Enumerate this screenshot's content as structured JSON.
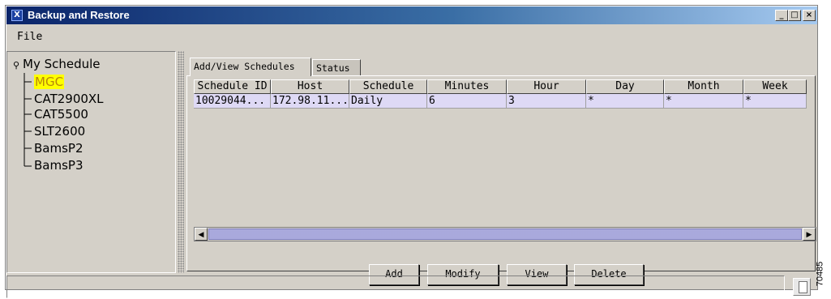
{
  "window": {
    "title": "Backup and Restore",
    "icon_glyph": "X",
    "buttons": {
      "minimize": "_",
      "maximize": "□",
      "close": "×"
    }
  },
  "menubar": {
    "items": [
      "File"
    ]
  },
  "tree": {
    "root_label": "My Schedule",
    "root_icon": "key-icon",
    "items": [
      "MGC",
      "CAT2900XL",
      "CAT5500",
      "SLT2600",
      "BamsP2",
      "BamsP3"
    ],
    "selected": "MGC"
  },
  "tabs": [
    "Add/View Schedules",
    "Status"
  ],
  "table": {
    "columns": [
      "Schedule ID",
      "Host",
      "Schedule",
      "Minutes",
      "Hour",
      "Day",
      "Month",
      "Week"
    ],
    "rows": [
      [
        "10029044...",
        "172.98.11...",
        "Daily",
        "6",
        "3",
        "*",
        "*",
        "*"
      ]
    ]
  },
  "buttons": {
    "add": "Add",
    "modify": "Modify",
    "view": "View",
    "delete": "Delete"
  },
  "statusbar": {
    "text": "",
    "icon": "document-icon"
  },
  "figure_code": "70485",
  "colors": {
    "selection_highlight": "#ffff00",
    "row_highlight": "#ded9f5",
    "title_bar": "#0a246a"
  }
}
